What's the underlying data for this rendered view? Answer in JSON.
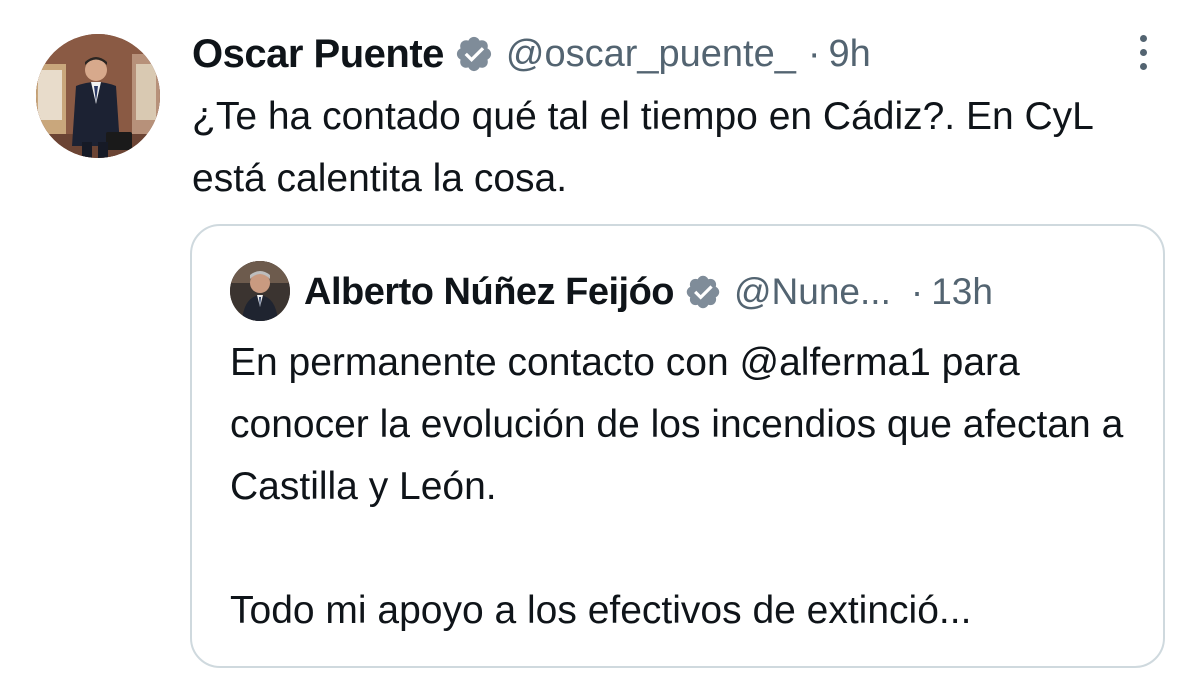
{
  "tweet": {
    "author_name": "Oscar Puente",
    "handle": "@oscar_puente_",
    "separator": "·",
    "time": "9h",
    "text": "¿Te ha contado qué tal el tiempo en Cádiz?. En CyL está calentita la cosa.",
    "verified_icon": "verified-badge-icon",
    "more_icon": "more-options-icon"
  },
  "quoted_tweet": {
    "author_name": "Alberto Núñez Feijóo",
    "handle": "@Nune...",
    "separator": "·",
    "time": "13h",
    "text_lines": [
      "En permanente contacto con @alferma1 para conocer la evolución de los incendios que afectan a Castilla y León.",
      "Todo mi apoyo a los efectivos de extinció..."
    ],
    "verified_icon": "verified-badge-icon"
  },
  "colors": {
    "text": "#0f1419",
    "secondary": "#536471",
    "border": "#cfd9de",
    "verified": "#7f8c99"
  }
}
